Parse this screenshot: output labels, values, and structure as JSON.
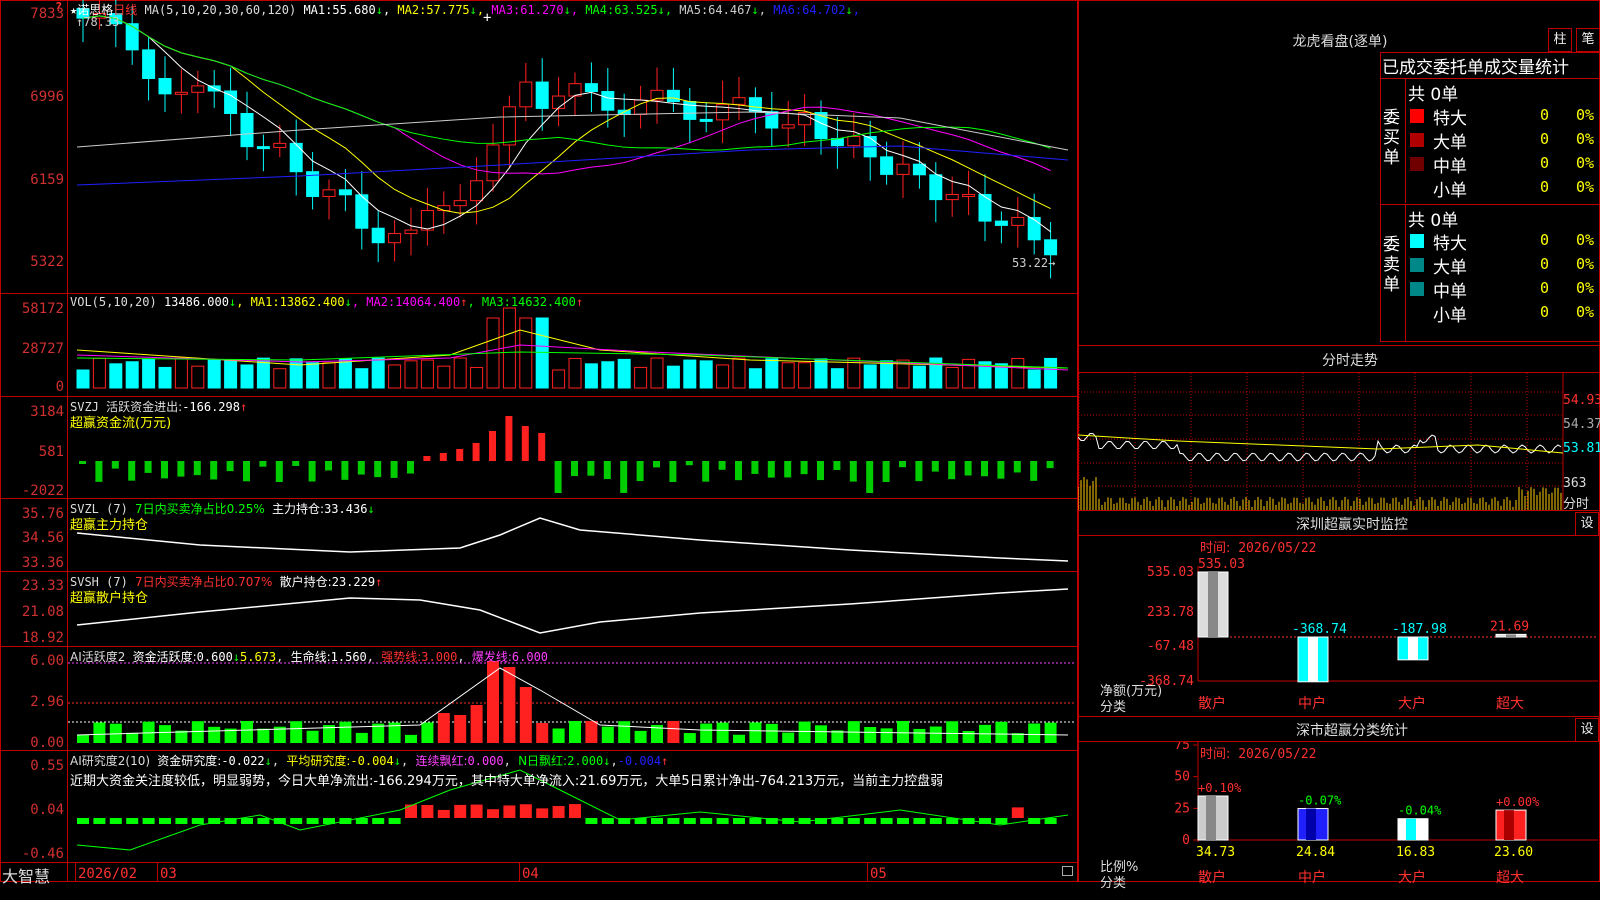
{
  "stock": {
    "star": "★",
    "name": "诺思格",
    "period": "日线",
    "last_price_tag": "53.22"
  },
  "price_panel": {
    "ma_header": "MA(5,10,20,30,60,120)",
    "ma": [
      {
        "label": "MA1:",
        "value": "55.680",
        "arrow": "↓",
        "color": "#ffffff"
      },
      {
        "label": "MA2:",
        "value": "57.775",
        "arrow": "↓",
        "color": "#ffff00"
      },
      {
        "label": "MA3:",
        "value": "61.270",
        "arrow": "↓",
        "color": "#ff00ff"
      },
      {
        "label": "MA4:",
        "value": "63.525",
        "arrow": "↓",
        "color": "#00ff00"
      },
      {
        "label": "MA5:",
        "value": "64.467",
        "arrow": "↓",
        "color": "#cccccc"
      },
      {
        "label": "MA6:",
        "value": "64.702",
        "arrow": "↓",
        "color": "#2020ff"
      }
    ],
    "high_tag": "78.33",
    "y_labels": [
      "7833",
      "6996",
      "6159",
      "5322"
    ]
  },
  "vol_panel": {
    "header": "VOL(5,10,20)",
    "value": "13486.000",
    "value_arrow": "↓",
    "ma": [
      {
        "label": "MA1:",
        "value": "13862.400",
        "arrow": "↓",
        "color": "#ffff00"
      },
      {
        "label": "MA2:",
        "value": "14064.400",
        "arrow": "↑",
        "color": "#ff00ff"
      },
      {
        "label": "MA3:",
        "value": "14632.400",
        "arrow": "↑",
        "color": "#00ff00"
      }
    ],
    "y_labels": [
      "58172",
      "28727",
      "0"
    ]
  },
  "svzj_panel": {
    "name": "SVZJ",
    "label": "活跃资金进出:",
    "value": "-166.298",
    "arrow": "↑",
    "subtitle": "超赢资金流(万元)",
    "y_labels": [
      "3184",
      "581",
      "-2022"
    ]
  },
  "svzl_panel": {
    "name": "SVZL (7)",
    "label": "7日内买卖净占比0.25%",
    "hold_label": "主力持仓:",
    "hold_value": "33.436",
    "arrow": "↓",
    "subtitle": "超赢主力持仓",
    "y_labels": [
      "35.76",
      "34.56",
      "33.36"
    ]
  },
  "svsh_panel": {
    "name": "SVSH (7)",
    "label": "7日内买卖净占比0.707%",
    "hold_label": "散户持仓:",
    "hold_value": "23.229",
    "arrow": "↑",
    "subtitle": "超赢散户持仓",
    "y_labels": [
      "23.33",
      "21.08",
      "18.92"
    ]
  },
  "ai_active_panel": {
    "name": "AI活跃度2",
    "label": "资金活跃度:",
    "value": "0.600",
    "value_arrow": "↓",
    "value2": "5.673",
    "life_label": "生命线:",
    "life_value": "1.560",
    "strong_label": "强势线:",
    "strong_value": "3.000",
    "burst_label": "爆发线:",
    "burst_value": "6.000",
    "y_labels": [
      "6.00",
      "2.96",
      "0.00"
    ]
  },
  "ai_research_panel": {
    "name": "AI研究度2(10)",
    "label": "资金研究度:",
    "value": "-0.022",
    "arrow": "↓",
    "avg_label": "平均研究度:",
    "avg_value": "-0.004",
    "avg_arrow": "↓",
    "red_label": "连续飘红:",
    "red_value": "0.000",
    "n_label": "N日飘红:",
    "n_value": "2.000",
    "n_arrow": "↓",
    "last": "-0.004",
    "last_arrow": "↑",
    "comment": "近期大资金关注度较低，明显弱势，今日大单净流出:-166.294万元，其中特大单净流入:21.69万元，大单5日累计净出-764.213万元，当前主力控盘弱",
    "y_labels": [
      "0.55",
      "0.04",
      "-0.46"
    ]
  },
  "x_axis": {
    "brand": "大智慧",
    "labels": [
      "2026/02",
      "03",
      "04",
      "05"
    ]
  },
  "dragon_tiger": {
    "title": "龙虎看盘(逐单)",
    "btn1": "柱",
    "btn2": "笔",
    "tabs": [
      "已成交",
      "委托单",
      "成交量统计"
    ],
    "buy_group_label": "委买单",
    "sell_group_label": "委卖单",
    "buy_total": "共 0单",
    "sell_total": "共 0单",
    "buy_rows": [
      {
        "color": "#ff0000",
        "label": "特大",
        "count": "0",
        "pct": "0%"
      },
      {
        "color": "#b00000",
        "label": "大单",
        "count": "0",
        "pct": "0%"
      },
      {
        "color": "#700000",
        "label": "中单",
        "count": "0",
        "pct": "0%"
      },
      {
        "color": "",
        "label": "小单",
        "count": "0",
        "pct": "0%"
      }
    ],
    "sell_rows": [
      {
        "color": "#00ffff",
        "label": "特大",
        "count": "0",
        "pct": "0%"
      },
      {
        "color": "#008888",
        "label": "大单",
        "count": "0",
        "pct": "0%"
      },
      {
        "color": "#008888",
        "label": "中单",
        "count": "0",
        "pct": "0%"
      },
      {
        "color": "",
        "label": "小单",
        "count": "0",
        "pct": "0%"
      }
    ]
  },
  "intraday": {
    "title": "分时走势",
    "y_labels": [
      "54.93",
      "54.37",
      "53.81"
    ],
    "vol_label": "363",
    "time_label": "分时"
  },
  "sz_monitor": {
    "title": "深圳超赢实时监控",
    "btn": "设",
    "time_label": "时间:",
    "date": "2026/05/22",
    "y_labels": [
      "535.03",
      "233.78",
      "-67.48",
      "-368.74"
    ],
    "axis_title": "净额(万元)",
    "axis_sub": "分类",
    "bars": [
      {
        "name": "散户",
        "value": 535.03,
        "label": "535.03"
      },
      {
        "name": "中户",
        "value": -368.74,
        "label": "-368.74"
      },
      {
        "name": "大户",
        "value": -187.98,
        "label": "-187.98"
      },
      {
        "name": "超大",
        "value": 21.69,
        "label": "21.69"
      }
    ]
  },
  "sz_class": {
    "title": "深市超赢分类统计",
    "btn": "设",
    "time_label": "时间:",
    "date": "2026/05/22",
    "y_labels": [
      "75",
      "50",
      "25",
      "0"
    ],
    "axis_title": "比例%",
    "axis_sub": "分类",
    "bars": [
      {
        "name": "散户",
        "value": 34.73,
        "label": "34.73",
        "delta": "+0.10%",
        "color": "#cccccc"
      },
      {
        "name": "中户",
        "value": 24.84,
        "label": "24.84",
        "delta": "-0.07%",
        "color": "#2020ff"
      },
      {
        "name": "大户",
        "value": 16.83,
        "label": "16.83",
        "delta": "-0.04%",
        "color": "#ffffff"
      },
      {
        "name": "超大",
        "value": 23.6,
        "label": "23.60",
        "delta": "+0.00%",
        "color": "#ff2020"
      }
    ]
  },
  "colors": {
    "up": "#ff2020",
    "down": "#00ffff",
    "frame": "#c00000",
    "axis_text": "#d03030"
  }
}
